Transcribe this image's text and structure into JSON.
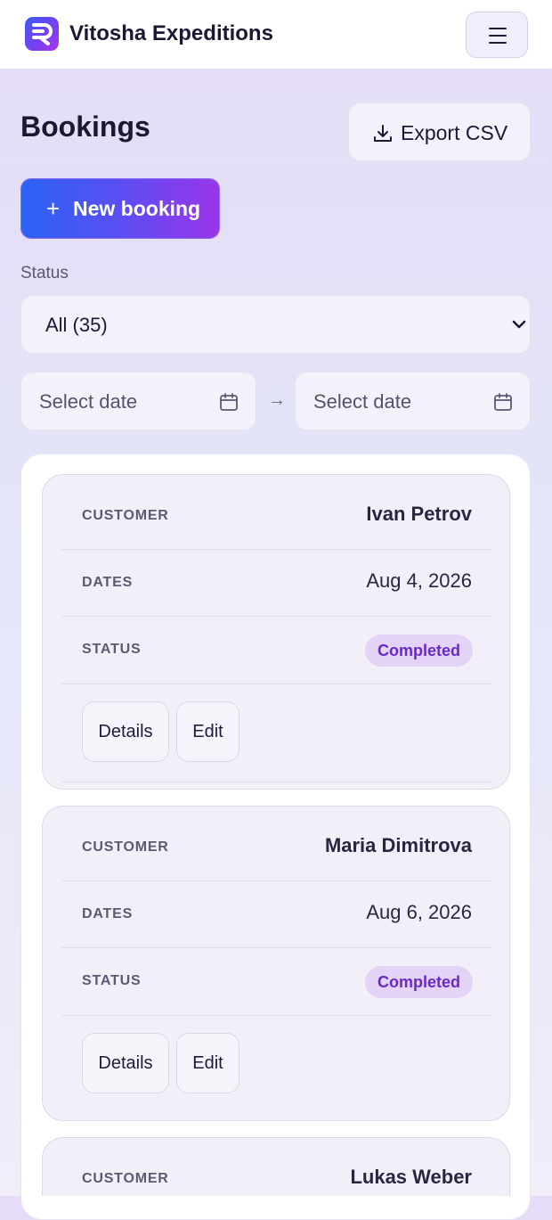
{
  "header": {
    "brand": "Vitosha Expeditions",
    "logo_icon": "logo-icon",
    "menu_icon": "hamburger-icon"
  },
  "page": {
    "title": "Bookings",
    "export_label": "Export CSV",
    "new_booking_label": "New booking"
  },
  "filters": {
    "status_label": "Status",
    "status_value": "All (35)",
    "date_from_placeholder": "Select date",
    "date_to_placeholder": "Select date",
    "range_arrow": "→"
  },
  "labels": {
    "customer": "CUSTOMER",
    "dates": "DATES",
    "status": "STATUS",
    "details": "Details",
    "edit": "Edit"
  },
  "bookings": [
    {
      "customer": "Ivan Petrov",
      "dates": "Aug 4, 2026",
      "status": "Completed"
    },
    {
      "customer": "Maria Dimitrova",
      "dates": "Aug 6, 2026",
      "status": "Completed"
    },
    {
      "customer": "Lukas Weber"
    }
  ],
  "colors": {
    "accent_start": "#2a64f4",
    "accent_end": "#9b35ea",
    "badge_bg": "#e3d3f6",
    "badge_text": "#6b28c9"
  }
}
